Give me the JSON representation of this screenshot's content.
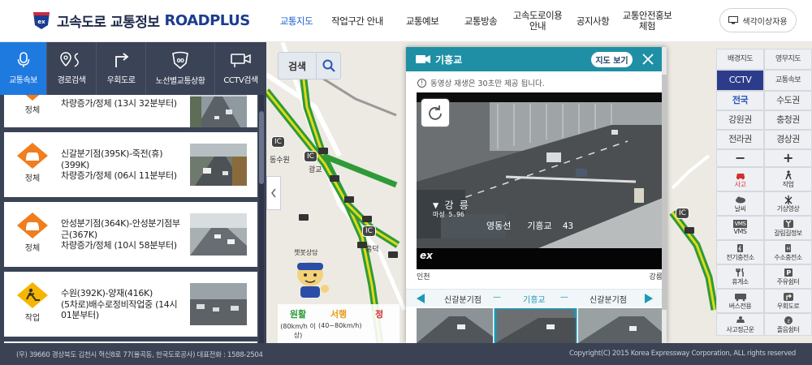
{
  "header": {
    "site_title": "고속도로 교통정보",
    "brand": "ROADPLUS",
    "nav": [
      "교통지도",
      "작업구간 안내",
      "교통예보",
      "교통방송",
      "고속도로이용안내",
      "공지사항",
      "교통안전홍보체험"
    ],
    "color_mode_label": "색각이상자용"
  },
  "left_panel": {
    "tabs": [
      {
        "label": "교통속보",
        "icon": "microphone-icon"
      },
      {
        "label": "경로검색",
        "icon": "route-pin-icon"
      },
      {
        "label": "우회도로",
        "icon": "detour-arrow-icon"
      },
      {
        "label": "노선별교통상황",
        "icon": "highway-shield-icon"
      },
      {
        "label": "CCTV검색",
        "icon": "cctv-camera-icon"
      }
    ],
    "items": [
      {
        "status": "정체",
        "text": "차량증가/정체 (13시 32분부터)"
      },
      {
        "status": "정체",
        "text": "신갈분기점(395K)-죽전(휴)(399K)\n차량증가/정체 (06시 11분부터)"
      },
      {
        "status": "정체",
        "text": "안성분기점(364K)-안성분기점부근(367K)\n차량증가/정체 (10시 58분부터)"
      },
      {
        "status": "작업",
        "text": "수원(392K)-양재(416K)\n(5차로)배수로정비작업중 (14시 01분부터)"
      }
    ]
  },
  "map": {
    "search_label": "검색",
    "labels": {
      "dongsuwon": "동수원",
      "gwanggyo": "광교",
      "heungdeok": "흥덕",
      "ic": "IC",
      "chatbot": "챗봇상담"
    },
    "speed_legend": [
      {
        "name": "원활",
        "range": "(80km/h 이상)",
        "color": "#2e9b38"
      },
      {
        "name": "서행",
        "range": "(40~80km/h)",
        "color": "#e59b18"
      },
      {
        "name": "정",
        "range": "",
        "color": "#d32f2f"
      }
    ],
    "tools": {
      "base_map": "배경지도",
      "satellite": "영무지도",
      "cctv": "CCTV",
      "traffic_news": "교통속보",
      "nationwide": "전국",
      "capital": "수도권",
      "gangwon": "강원권",
      "chungcheong": "충청권",
      "jeolla": "전라권",
      "gyeongsang": "경상권",
      "zoom_out": "−",
      "zoom_in": "+",
      "icons": [
        [
          "사고",
          "작업"
        ],
        [
          "날씨",
          "기상영상"
        ],
        [
          "VMS",
          "갈림길정보"
        ],
        [
          "전기충전소",
          "수소충전소"
        ],
        [
          "휴게소",
          "주유쉼터"
        ],
        [
          "버스전용",
          "우회도로"
        ],
        [
          "사고정근운",
          "졸음쉼터"
        ]
      ]
    }
  },
  "cctv_popup": {
    "title": "기흥교",
    "map_view_label": "지도 보기",
    "notice": "동영상 재생은 30초만 제공 됩니다.",
    "video": {
      "direction": "강 릉",
      "marker": "마성 5.96",
      "location": "영동선   기흥교  43",
      "watermark": "ex"
    },
    "direction_left": "인천",
    "direction_right": "강릉",
    "prev": "신갈분기점",
    "current": "기흥교",
    "next": "신갈분기점"
  },
  "footer": {
    "address": "(우) 39660 경상북도 김천시 혁신8로 77(율곡동, 한국도로공사) 대표전화 : 1588-2504",
    "copyright": "Copyright(C) 2015 Korea Expressway Corporation, ALL rights reserved"
  },
  "colors": {
    "header_nav_active": "#1f5fd0",
    "panel_dark": "#3b4357",
    "tab_active": "#1f7ae0",
    "cctv_header": "#1e8fa5",
    "congestion": "#f07d1e",
    "work": "#f6b500"
  }
}
